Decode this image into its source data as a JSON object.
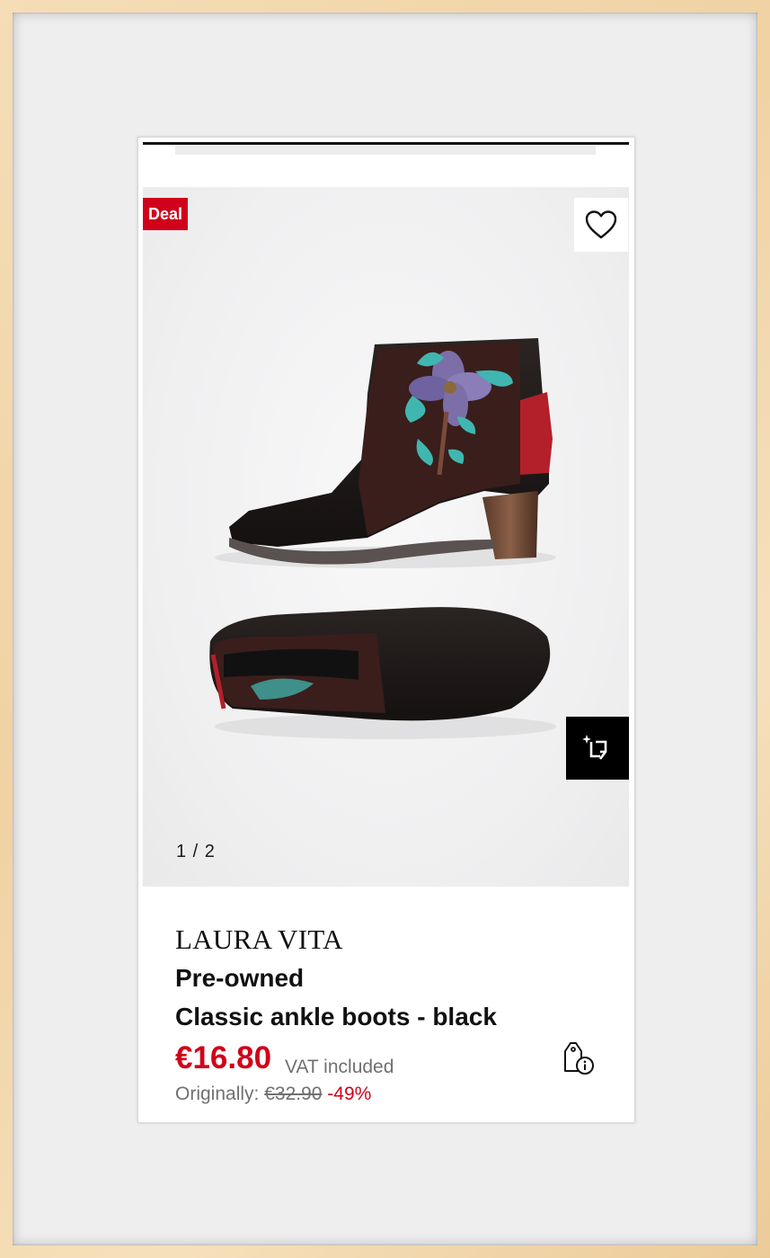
{
  "product": {
    "badge": "Deal",
    "image_counter": "1 / 2",
    "brand": "LAURA VITA",
    "condition": "Pre-owned",
    "title": "Classic ankle boots - black",
    "price": "€16.80",
    "vat_note": "VAT included",
    "original_label": "Originally:",
    "original_price": "€32.90",
    "discount": "-49%"
  },
  "icons": {
    "favorite": "heart-icon",
    "crop": "crop-sparkle-icon",
    "price_info": "tag-info-icon"
  },
  "colors": {
    "accent_red": "#d0021b",
    "text": "#111111",
    "muted": "#707070"
  }
}
